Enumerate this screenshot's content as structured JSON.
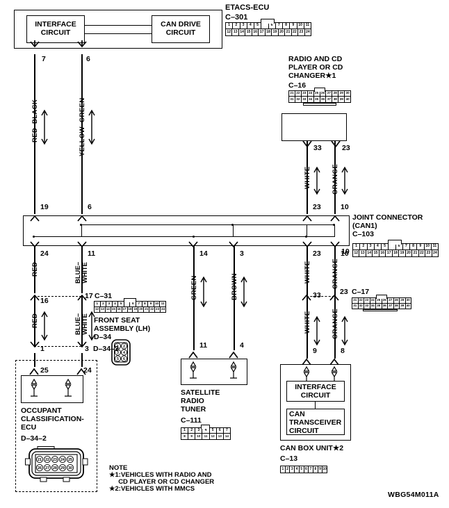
{
  "diagram": {
    "code": "WBG54M011A",
    "note_title": "NOTE",
    "note_lines": [
      "★1:VEHICLES WITH RADIO AND",
      "     CD PLAYER OR CD CHANGER",
      "★2:VEHICLES WITH MMCS"
    ]
  },
  "components": {
    "etacs": {
      "title": "ETACS-ECU",
      "connector": "C–301",
      "block_a": "INTERFACE\nCIRCUIT",
      "block_b": "CAN DRIVE\nCIRCUIT",
      "pins_top": [
        "1",
        "2",
        "3",
        "4",
        "5",
        "",
        "6",
        "7",
        "8",
        "9",
        "10",
        "11"
      ],
      "pins_bottom": [
        "12",
        "13",
        "14",
        "15",
        "16",
        "17",
        "18",
        "19",
        "20",
        "21",
        "22",
        "23",
        "24"
      ]
    },
    "radio": {
      "title_lines": [
        "RADIO AND CD",
        "PLAYER OR CD",
        "CHANGER★1"
      ],
      "connector": "C–16",
      "pins_top": [
        "21",
        "22",
        "23",
        "24",
        "25",
        "26",
        "27",
        "28",
        "29",
        "30"
      ],
      "pins_bottom": [
        "31",
        "32",
        "33",
        "34",
        "35",
        "36",
        "37",
        "38",
        "39",
        "40"
      ]
    },
    "joint": {
      "title_lines": [
        "JOINT CONNECTOR",
        "(CAN1)"
      ],
      "connector": "C–103",
      "pins_top": [
        "1",
        "2",
        "3",
        "4",
        "5",
        "",
        "6",
        "7",
        "8",
        "9",
        "10",
        "11"
      ],
      "pins_bottom": [
        "12",
        "13",
        "14",
        "15",
        "16",
        "17",
        "18",
        "19",
        "20",
        "21",
        "22",
        "23",
        "24"
      ]
    },
    "c17": {
      "connector": "C–17",
      "pins_top": [
        "21",
        "22",
        "23",
        "24",
        "25",
        "26",
        "27",
        "28",
        "29",
        "30"
      ],
      "pins_bottom": [
        "31",
        "32",
        "33",
        "34",
        "35",
        "36",
        "37",
        "38",
        "39",
        "40"
      ]
    },
    "c31": {
      "connector": "C–31",
      "pins_top": [
        "1",
        "2",
        "3",
        "4",
        "5",
        "",
        "6",
        "7",
        "8",
        "9",
        "10",
        "11"
      ],
      "pins_bottom": [
        "12",
        "13",
        "14",
        "15",
        "16",
        "17",
        "18",
        "19",
        "20",
        "21",
        "22",
        "23",
        "24"
      ]
    },
    "front_seat": {
      "title_lines": [
        "FRONT SEAT",
        "ASSEMBLY (LH)"
      ],
      "connector": "D–34",
      "pins": [
        "1",
        "2",
        "3",
        "4",
        "5",
        "6"
      ]
    },
    "occupant": {
      "title_lines": [
        "OCCUPANT",
        "CLASSIFICATION-",
        "ECU"
      ],
      "connector": "D–34–2",
      "pins_top": [
        "21",
        "22",
        "23",
        "24",
        "25"
      ],
      "pins_bottom": [
        "26",
        "27",
        "28",
        "29",
        "30"
      ]
    },
    "satellite": {
      "title_lines": [
        "SATELLITE",
        "RADIO",
        "TUNER"
      ],
      "connector": "C–111",
      "pins_top": [
        "1",
        "2",
        "3",
        "4",
        "5",
        "6",
        "7"
      ],
      "pins_bottom": [
        "8",
        "9",
        "10",
        "11",
        "12",
        "13",
        "14"
      ]
    },
    "canbox": {
      "title": "CAN BOX UNIT★2",
      "connector": "C–13",
      "block_a": "INTERFACE\nCIRCUIT",
      "block_b": "CAN\nTRANSCEIVER\nCIRCUIT",
      "pins": [
        "1",
        "2",
        "3",
        "4",
        "5",
        "6",
        "7",
        "8",
        "9",
        "10"
      ]
    }
  },
  "wires": [
    {
      "name": "red-black",
      "color_label": "RED–BLACK",
      "top_pin": "7",
      "bottom_pin": "19"
    },
    {
      "name": "yellow-green",
      "color_label": "YELLOW–GREEN",
      "top_pin": "6",
      "bottom_pin": "6"
    },
    {
      "name": "red-upper",
      "color_label": "RED",
      "top_pin": "24",
      "bottom_pin": "16"
    },
    {
      "name": "blue-white-upper",
      "color_label": "BLUE–\nWHITE",
      "top_pin": "11",
      "bottom_pin": "17"
    },
    {
      "name": "red-lower",
      "color_label": "RED",
      "top_pin": "16",
      "bottom_pin": "1"
    },
    {
      "name": "blue-white-lower",
      "color_label": "BLUE–\nWHITE",
      "top_pin": "17",
      "bottom_pin": "3"
    },
    {
      "name": "green",
      "color_label": "GREEN",
      "top_pin": "14",
      "bottom_pin": "11"
    },
    {
      "name": "brown",
      "color_label": "BROWN",
      "top_pin": "3",
      "bottom_pin": "4"
    },
    {
      "name": "white-upper",
      "color_label": "WHITE",
      "top_pin": "33",
      "bottom_pin": "23"
    },
    {
      "name": "orange-upper",
      "color_label": "ORANGE",
      "top_pin": "23",
      "bottom_pin": "10"
    },
    {
      "name": "white-mid",
      "color_label": "WHITE",
      "top_pin": "23",
      "bottom_pin": "33"
    },
    {
      "name": "orange-mid",
      "color_label": "ORANGE",
      "top_pin": "10",
      "bottom_pin": "23"
    },
    {
      "name": "white-lower",
      "color_label": "WHITE",
      "top_pin": "",
      "bottom_pin": "9"
    },
    {
      "name": "orange-lower",
      "color_label": "ORANGE",
      "top_pin": "",
      "bottom_pin": "8"
    }
  ],
  "pin_labels": {
    "etacs_out_left": "7",
    "etacs_out_right": "6",
    "joint_in_left": "19",
    "joint_in_right": "6",
    "joint_out_left": "24",
    "joint_out_right": "11",
    "seat_in_left": "16",
    "seat_in_right": "17",
    "occ_left": "1",
    "occ_right": "3",
    "occ_pin_left": "25",
    "occ_pin_right": "24",
    "sat_top_left": "14",
    "sat_top_right": "3",
    "sat_bot_left": "11",
    "sat_bot_right": "4",
    "radio_out_left": "33",
    "radio_out_right": "23",
    "joint_r_in_left": "23",
    "joint_r_in_right": "10",
    "joint_r_out_left": "23",
    "joint_r_out_right": "10",
    "c17_left": "33",
    "c17_right": "23",
    "canbox_left": "9",
    "canbox_right": "8",
    "joint_side_left": "10"
  }
}
